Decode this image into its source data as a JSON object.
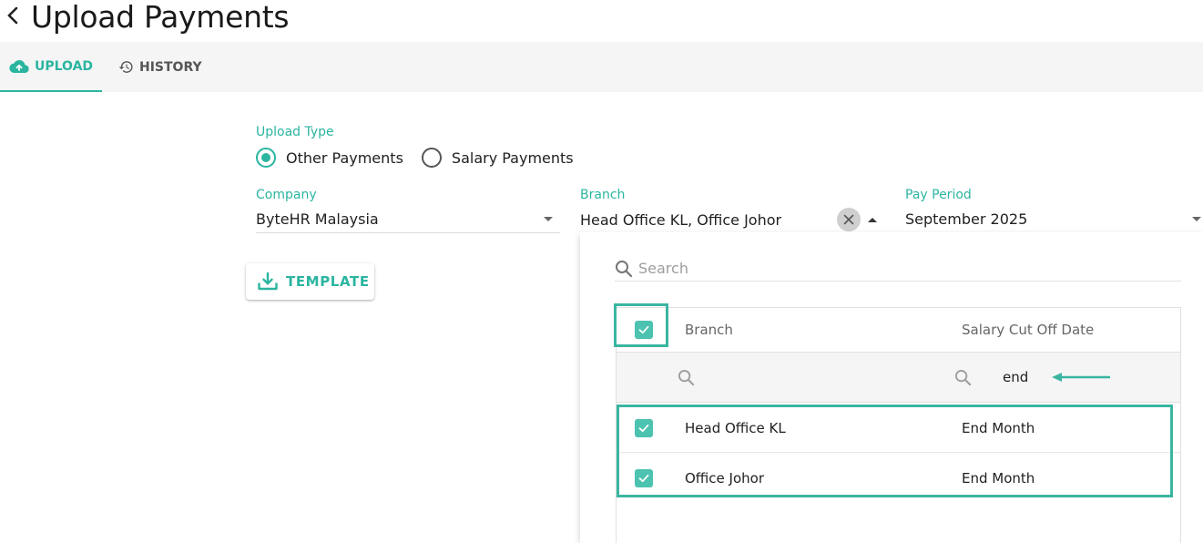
{
  "header": {
    "title": "Upload Payments",
    "back_icon": "chevron-left-icon"
  },
  "tabs": [
    {
      "label": "UPLOAD",
      "icon": "cloud-upload-icon",
      "active": true
    },
    {
      "label": "HISTORY",
      "icon": "history-icon",
      "active": false
    }
  ],
  "form": {
    "upload_type_label": "Upload Type",
    "upload_type_options": [
      {
        "label": "Other Payments",
        "selected": true
      },
      {
        "label": "Salary Payments",
        "selected": false
      }
    ],
    "company": {
      "label": "Company",
      "value": "ByteHR Malaysia"
    },
    "branch": {
      "label": "Branch",
      "value": "Head Office KL, Office Johor"
    },
    "pay_period": {
      "label": "Pay Period",
      "value": "September 2025"
    },
    "template_button": "TEMPLATE"
  },
  "branch_dropdown": {
    "search_placeholder": "Search",
    "columns": [
      "Branch",
      "Salary Cut Off Date"
    ],
    "filter_values": {
      "branch": "",
      "salary_cut_off_date": "end"
    },
    "select_all_checked": true,
    "rows": [
      {
        "branch": "Head Office KL",
        "salary_cut_off_date": "End Month",
        "checked": true
      },
      {
        "branch": "Office Johor",
        "salary_cut_off_date": "End Month",
        "checked": true
      }
    ]
  },
  "colors": {
    "accent": "#2bb5a0",
    "checkbox": "#4cc2b0",
    "highlight": "#3bb5a1",
    "tab_bar_bg": "#f5f5f5"
  }
}
